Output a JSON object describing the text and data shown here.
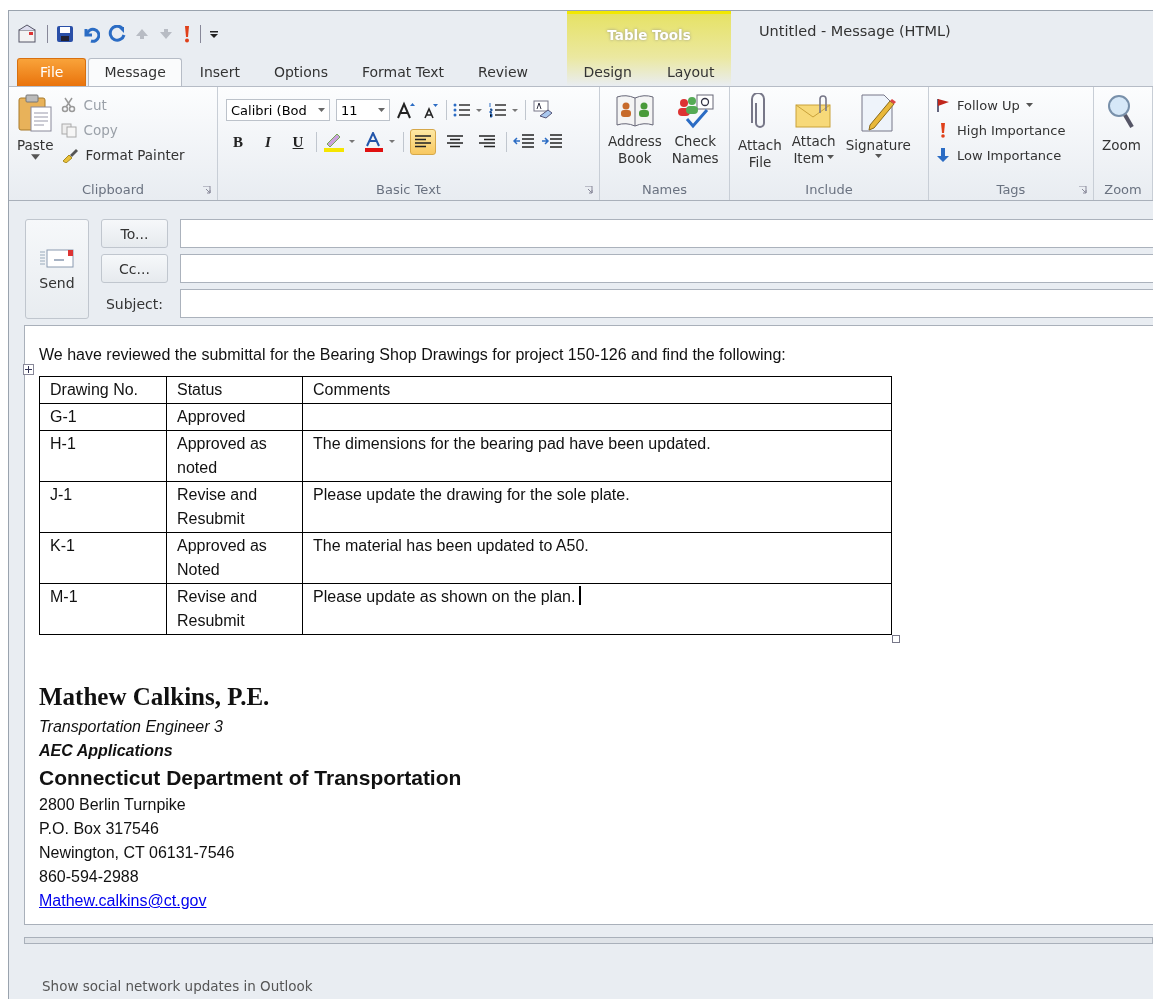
{
  "window": {
    "title": "Untitled  -  Message (HTML)"
  },
  "contextual_tab": {
    "label": "Table Tools"
  },
  "tabs": [
    {
      "label": "File",
      "kind": "file",
      "selected": false
    },
    {
      "label": "Message",
      "kind": "normal",
      "selected": true
    },
    {
      "label": "Insert",
      "kind": "normal",
      "selected": false
    },
    {
      "label": "Options",
      "kind": "normal",
      "selected": false
    },
    {
      "label": "Format Text",
      "kind": "normal",
      "selected": false
    },
    {
      "label": "Review",
      "kind": "normal",
      "selected": false
    },
    {
      "label": "Design",
      "kind": "contextual",
      "selected": false
    },
    {
      "label": "Layout",
      "kind": "contextual",
      "selected": false
    }
  ],
  "ribbon": {
    "groups": [
      {
        "label": "Clipboard",
        "launcher": true,
        "large": [
          {
            "lines": [
              "Paste"
            ],
            "dropdown": true
          }
        ],
        "small": [
          {
            "label": "Cut",
            "disabled": true
          },
          {
            "label": "Copy",
            "disabled": true
          },
          {
            "label": "Format Painter",
            "disabled": false
          }
        ]
      },
      {
        "label": "Basic Text",
        "launcher": true,
        "font": "Calibri (Bod",
        "size": "11",
        "format_buttons": [
          "B",
          "I",
          "U"
        ],
        "alignment": [
          {
            "selected": true
          },
          {
            "selected": false
          },
          {
            "selected": false
          }
        ]
      },
      {
        "label": "Names",
        "large": [
          {
            "lines": [
              "Address",
              "Book"
            ]
          },
          {
            "lines": [
              "Check",
              "Names"
            ]
          }
        ]
      },
      {
        "label": "Include",
        "large": [
          {
            "lines": [
              "Attach",
              "File"
            ]
          },
          {
            "lines": [
              "Attach",
              "Item"
            ],
            "dropdown": true
          },
          {
            "lines": [
              "Signature"
            ],
            "dropdown": true
          }
        ]
      },
      {
        "label": "Tags",
        "launcher": true,
        "small": [
          {
            "label": "Follow Up",
            "dropdown": true
          },
          {
            "label": "High Importance"
          },
          {
            "label": "Low Importance"
          }
        ]
      },
      {
        "label": "Zoom",
        "large": [
          {
            "lines": [
              "Zoom"
            ]
          }
        ]
      }
    ]
  },
  "compose": {
    "send": "Send",
    "fields": [
      {
        "label": "To...",
        "kind": "button"
      },
      {
        "label": "Cc...",
        "kind": "button"
      },
      {
        "label": "Subject:",
        "kind": "label"
      }
    ]
  },
  "body": {
    "intro": "We have reviewed the submittal for the Bearing Shop Drawings for project 150-126 and find the following:",
    "table": {
      "columns": [
        "Drawing No.",
        "Status",
        "Comments"
      ],
      "rows": [
        [
          "G-1",
          "Approved",
          ""
        ],
        [
          "H-1",
          "Approved as noted",
          "The dimensions for the bearing pad have been updated."
        ],
        [
          "J-1",
          "Revise and Resubmit",
          "Please update the drawing for the sole plate."
        ],
        [
          "K-1",
          "Approved as Noted",
          "The material has been updated to A50."
        ],
        [
          "M-1",
          "Revise and Resubmit",
          "Please update as shown on the plan."
        ]
      ]
    },
    "signature": {
      "name": "Mathew Calkins, P.E.",
      "title": "Transportation Engineer 3",
      "unit": "AEC Applications",
      "agency": "Connecticut Department of Transportation",
      "lines": [
        "2800 Berlin Turnpike",
        "P.O. Box 317546",
        "Newington, CT 06131-7546",
        "860-594-2988"
      ],
      "email": "Mathew.calkins@ct.gov"
    }
  },
  "social_bar": {
    "text": "Show social network updates in Outlook"
  }
}
